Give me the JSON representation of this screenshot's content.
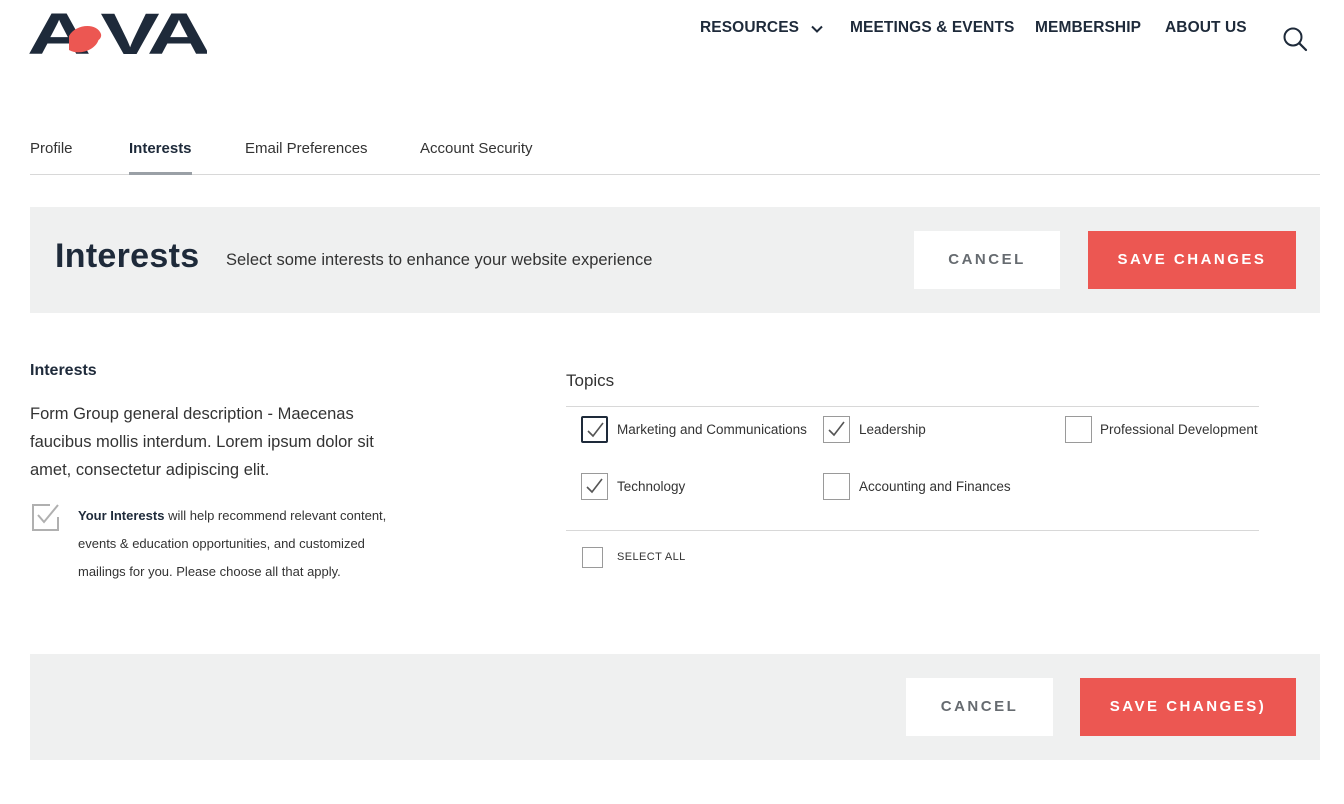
{
  "header": {
    "logo_text": "AeVA",
    "nav": [
      {
        "label": "RESOURCES"
      },
      {
        "label": "MEETINGS & EVENTS"
      },
      {
        "label": "MEMBERSHIP"
      },
      {
        "label": "ABOUT US"
      }
    ],
    "icons": {
      "dropdown": "chevron-down-icon",
      "search": "search-icon"
    }
  },
  "tabs": [
    {
      "label": "Profile",
      "active": false
    },
    {
      "label": "Interests",
      "active": true
    },
    {
      "label": "Email Preferences",
      "active": false
    },
    {
      "label": "Account Security",
      "active": false
    }
  ],
  "top_panel": {
    "title": "Interests",
    "subtitle": "Select some interests to enhance your website experience",
    "cancel_label": "CANCEL",
    "save_label": "SAVE CHANGES"
  },
  "form": {
    "heading": "Interests",
    "description": "Form Group general description - Maecenas faucibus mollis interdum. Lorem ipsum dolor sit amet, consectetur adipiscing elit.",
    "note_bold": "Your Interests",
    "note_rest": " will help recommend relevant content, events & education opportunities, and customized mailings for you. Please choose all that apply.",
    "topics_label": "Topics",
    "topics": [
      {
        "label": "Marketing and Communications",
        "checked": true
      },
      {
        "label": "Leadership",
        "checked": true
      },
      {
        "label": "Professional Development",
        "checked": false
      },
      {
        "label": "Technology",
        "checked": true
      },
      {
        "label": "Accounting and Finances",
        "checked": false
      }
    ],
    "select_all_label": "SELECT ALL",
    "select_all_checked": false
  },
  "bottom_panel": {
    "cancel_label": "CANCEL",
    "save_label": "SAVE CHANGES)"
  },
  "colors": {
    "brand_navy": "#1e2a3a",
    "brand_red": "#ec5752",
    "panel_gray": "#eff0f0"
  }
}
